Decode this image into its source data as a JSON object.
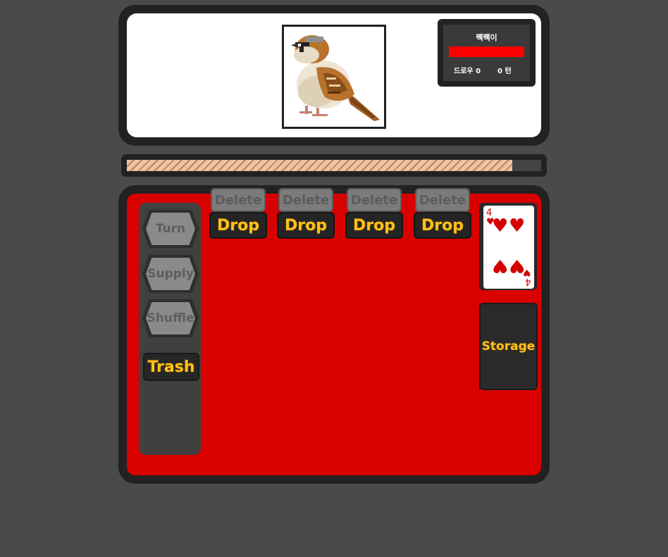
{
  "enemy": {
    "name": "짹짹이",
    "portrait": "sparrow-pixel-art",
    "hp_fraction": 1.0,
    "hp_color": "#ff0000",
    "draw_label": "드로우",
    "draw_count": "0",
    "turn_count": "0",
    "turn_label": "턴"
  },
  "progress": {
    "fraction": 0.93
  },
  "sidebar": {
    "turn_label": "Turn",
    "supply_label": "Supply",
    "shuffle_label": "Shuffle",
    "trash_label": "Trash"
  },
  "slots": [
    {
      "delete_label": "Delete",
      "drop_label": "Drop"
    },
    {
      "delete_label": "Delete",
      "drop_label": "Drop"
    },
    {
      "delete_label": "Delete",
      "drop_label": "Drop"
    },
    {
      "delete_label": "Delete",
      "drop_label": "Drop"
    }
  ],
  "deck_card": {
    "rank": "4",
    "suit": "hearts",
    "suit_symbol": "♥",
    "color": "#d40000"
  },
  "storage_label": "Storage",
  "colors": {
    "board": "#d90000",
    "button_text": "#ffc21a",
    "disabled_button": "#8a8a8a"
  }
}
